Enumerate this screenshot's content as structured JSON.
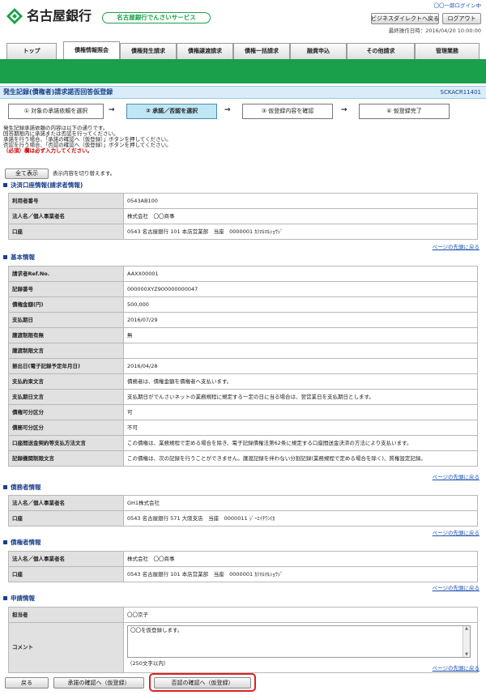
{
  "header": {
    "bank_name": "名古屋銀行",
    "service_name": "名古屋銀行でんさいサービス",
    "user_login": "〇〇一郎ログイン中",
    "btn_business_direct": "ビジネスダイレクトへ戻る",
    "btn_logout": "ログアウト",
    "last_operation": "最終操作日時：2016/04/20 10:00:00"
  },
  "tabs": [
    "トップ",
    "債権情報照会",
    "債権発生請求",
    "債権譲渡請求",
    "債権一括請求",
    "融資申込",
    "その他請求",
    "管理業務"
  ],
  "page": {
    "title": "発生記録(債権者)請求諾否回答仮登録",
    "screen_id": "SCKACR11401"
  },
  "steps": [
    "① 対象の承諾依頼を選択",
    "② 承諾／否認を選択",
    "③ 仮登録内容を確認",
    "④ 仮登録完了"
  ],
  "notes": [
    "発生記録承諾依頼の内容は以下の通りです。",
    "回答期限内に承諾または否認を行ってください。",
    "承諾を行う場合、「承諾の確認へ（仮登録）」ボタンを押してください。",
    "否認を行う場合、「否認の確認へ（仮登録）」ボタンを押してください。",
    "（必須）欄は必ず入力してください。"
  ],
  "show_all": {
    "button": "全て表示",
    "desc": "表示内容を切り替えます。"
  },
  "page_top_link": "ページの先頭に戻る",
  "sections": {
    "settlement": {
      "title": "決済口座情報(請求者情報)",
      "rows": [
        {
          "label": "利用者番号",
          "value": "0543AB100"
        },
        {
          "label": "法人名／個人事業者名",
          "value": "株式会社　〇〇商事"
        },
        {
          "label": "口座",
          "value": "0543 名古屋銀行 101 本店営業部　当座　0000001 ｶ)ﾏﾙﾏﾙｼｮｳｼﾞ"
        }
      ]
    },
    "basic": {
      "title": "基本情報",
      "rows": [
        {
          "label": "請求者Ref.No.",
          "value": "AAXX00001"
        },
        {
          "label": "記録番号",
          "value": "000000XYZ900000000047"
        },
        {
          "label": "債権金額(円)",
          "value": "500,000"
        },
        {
          "label": "支払期日",
          "value": "2016/07/29"
        },
        {
          "label": "譲渡制限有無",
          "value": "無"
        },
        {
          "label": "譲渡制限文言",
          "value": ""
        },
        {
          "label": "振出日(電子記録予定年月日)",
          "value": "2016/04/28"
        },
        {
          "label": "支払約束文言",
          "value": "債務者は、債権金額を債権者へ支払います。"
        },
        {
          "label": "支払期日文言",
          "value": "支払期日がでんさいネットの業務規程に規定する一定の日に当る場合は、翌営業日を支払期日とします。"
        },
        {
          "label": "債権可分区分",
          "value": "可"
        },
        {
          "label": "債務可分区分",
          "value": "不可"
        },
        {
          "label": "口座間送金契約等支払方法文言",
          "value": "この債権は、業務規程で定める場合を除き、電子記録債権法第62条に規定する口座間送金決済の方法により支払います。"
        },
        {
          "label": "記録機関制限文言",
          "value": "この債権は、次の記録を行うことができません。譲渡記録を伴わない分割記録(業務規程で定める場合を除く)、質権設定記録。"
        }
      ]
    },
    "debtor": {
      "title": "債務者情報",
      "rows": [
        {
          "label": "法人名／個人事業者名",
          "value": "GH1株式会社"
        },
        {
          "label": "口座",
          "value": "0543 名古屋銀行 571 大阪支店　当座　0000011 ｼﾞｰｴｲﾁﾜﾝ(ｶ"
        }
      ]
    },
    "creditor": {
      "title": "債権者情報",
      "rows": [
        {
          "label": "法人名／個人事業者名",
          "value": "株式会社　〇〇商事"
        },
        {
          "label": "口座",
          "value": "0543 名古屋銀行 101 本店営業部　当座　0000001 ｶ)ﾏﾙﾏﾙｼｮｳｼﾞ"
        }
      ]
    },
    "application": {
      "title": "申請情報",
      "person_label": "担当者",
      "person_value": "〇〇京子",
      "comment_label": "コメント",
      "comment_value": "〇〇を仮登録します。",
      "comment_hint": "（250文字以内）"
    }
  },
  "footer": {
    "btn_back": "戻る",
    "btn_approve": "承諾の確認へ（仮登録）",
    "btn_reject": "否認の確認へ（仮登録）"
  },
  "colors": {
    "green_band": "#1aa04a",
    "accent_blue": "#1a3f8a",
    "highlight_red": "#e02020"
  }
}
